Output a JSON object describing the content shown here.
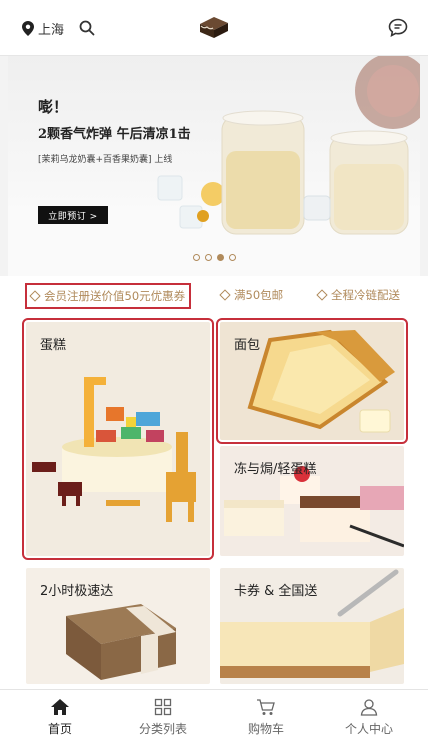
{
  "header": {
    "location": "上海"
  },
  "banner": {
    "title_line1": "嘭！",
    "title_line2": "2颗香气炸弹  午后清凉1击",
    "subtitle": "[茉莉乌龙奶囊+百香果奶囊] 上线",
    "cta": "立即预订 >"
  },
  "features": [
    {
      "label": "会员注册送价值50元优惠券"
    },
    {
      "label": "满50包邮"
    },
    {
      "label": "全程冷链配送"
    }
  ],
  "categories": [
    {
      "label": "蛋糕"
    },
    {
      "label": "面包"
    },
    {
      "label": "冻与焗/轻蛋糕"
    },
    {
      "label": "2小时极速达"
    },
    {
      "label": "卡券 & 全国送"
    }
  ],
  "tabs": [
    {
      "label": "首页"
    },
    {
      "label": "分类列表"
    },
    {
      "label": "购物车"
    },
    {
      "label": "个人中心"
    }
  ],
  "colors": {
    "accent": "#b08a5b",
    "highlight": "#c62f3b"
  }
}
